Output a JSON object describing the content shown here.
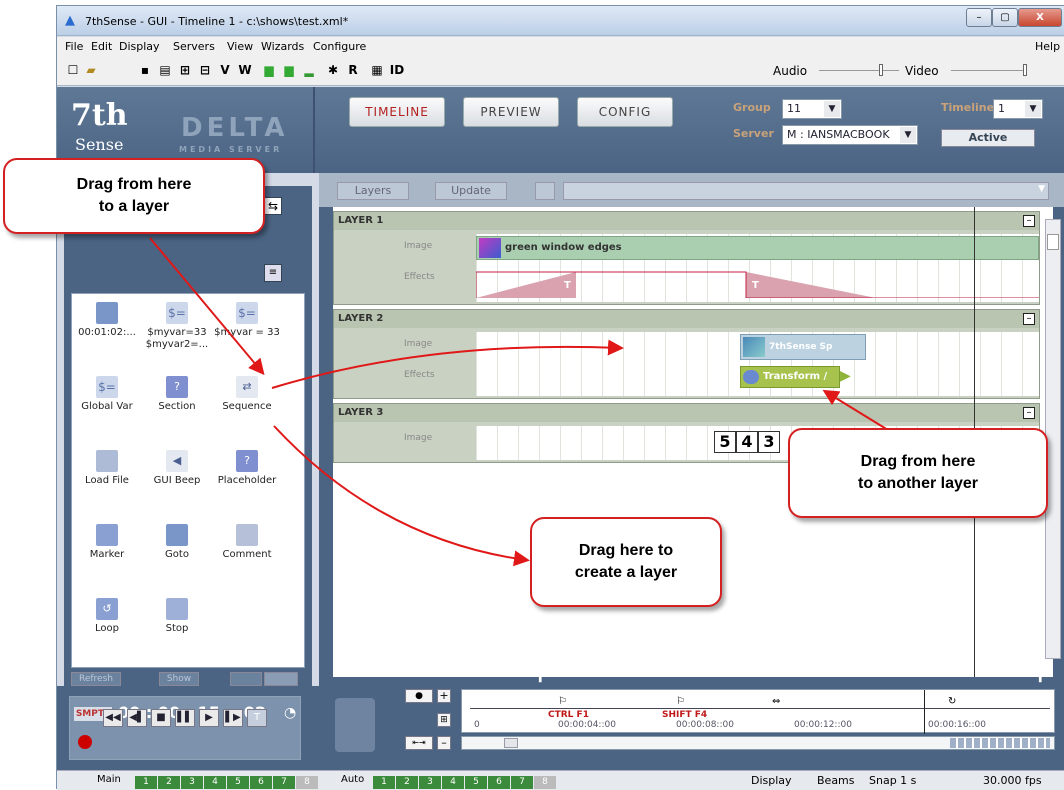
{
  "window": {
    "title": "7thSense -  GUI - Timeline 1 - c:\\shows\\test.xml*",
    "min": "–",
    "max": "▢",
    "close": "X"
  },
  "menu": {
    "file": "File",
    "edit": "Edit",
    "display": "Display",
    "servers": "Servers",
    "view": "View",
    "wizards": "Wizards",
    "configure": "Configure",
    "help": "Help"
  },
  "toolbar": {
    "v": "V",
    "w": "W",
    "r": "R",
    "id": "ID",
    "audio": "Audio",
    "video": "Video"
  },
  "brand": {
    "logo_main": "7th",
    "logo_sub": "Sense",
    "delta": "DELTA",
    "media_server": "MEDIA SERVER"
  },
  "tabs": {
    "timeline": "TIMELINE",
    "preview": "PREVIEW",
    "config": "CONFIG"
  },
  "group": {
    "label": "Group",
    "value": "11"
  },
  "server": {
    "label": "Server",
    "value": "M : IANSMACBOOK"
  },
  "timeline_sel": {
    "label": "Timeline",
    "value": "1",
    "status": "Active"
  },
  "layers_bar": {
    "layers": "Layers",
    "update": "Update"
  },
  "palette": {
    "items": [
      {
        "label": "00:01:02:...",
        "icon": "goto-arrow-icon"
      },
      {
        "label": "$myvar=33\n$myvar2=...",
        "icon": "dollar-equals-icon"
      },
      {
        "label": "$myvar = 33",
        "icon": "dollar-equals-icon"
      },
      {
        "label": "Global Var",
        "icon": "dollar-equals-icon"
      },
      {
        "label": "Section",
        "icon": "question-icon"
      },
      {
        "label": "Sequence",
        "icon": "sequence-icon"
      },
      {
        "label": "Load File",
        "icon": "save-icon"
      },
      {
        "label": "GUI Beep",
        "icon": "speaker-icon"
      },
      {
        "label": "Placeholder",
        "icon": "question-icon"
      },
      {
        "label": "Marker",
        "icon": "marker-flag-icon"
      },
      {
        "label": "Goto",
        "icon": "goto-arrow-icon"
      },
      {
        "label": "Comment",
        "icon": "comment-icon"
      },
      {
        "label": "Loop",
        "icon": "loop-icon"
      },
      {
        "label": "Stop",
        "icon": "stop-hand-icon"
      }
    ],
    "refresh": "Refresh",
    "show": "Show"
  },
  "layers": [
    {
      "name": "LAYER 1",
      "image_label": "Image",
      "effects_label": "Effects",
      "clip": "green window edges",
      "effect_t1": "T",
      "effect_t2": "T"
    },
    {
      "name": "LAYER 2",
      "image_label": "Image",
      "effects_label": "Effects",
      "clip": "7thSense Sp",
      "effect_clip": "Transform /"
    },
    {
      "name": "LAYER 3",
      "image_label": "Image",
      "digits": [
        "5",
        "4",
        "3"
      ]
    }
  ],
  "transport": {
    "smpte": "SMPTE",
    "timecode": "00 : 00 : 15 :: 02"
  },
  "ruler": {
    "marks": [
      "0",
      "00:00:04::00",
      "00:00:08::00",
      "00:00:12::00",
      "00:00:16::00"
    ],
    "cue1": "CTRL F1",
    "cue2": "SHIFT F4"
  },
  "status": {
    "main": "Main",
    "auto": "Auto",
    "nums": [
      "1",
      "2",
      "3",
      "4",
      "5",
      "6",
      "7",
      "8"
    ],
    "display": "Display",
    "beams": "Beams",
    "snap": "Snap 1 s",
    "fps": "30.000 fps"
  },
  "callouts": {
    "c1": "Drag from here\nto a layer",
    "c2": "Drag from here\nto another layer",
    "c3": "Drag here to\ncreate a layer"
  }
}
